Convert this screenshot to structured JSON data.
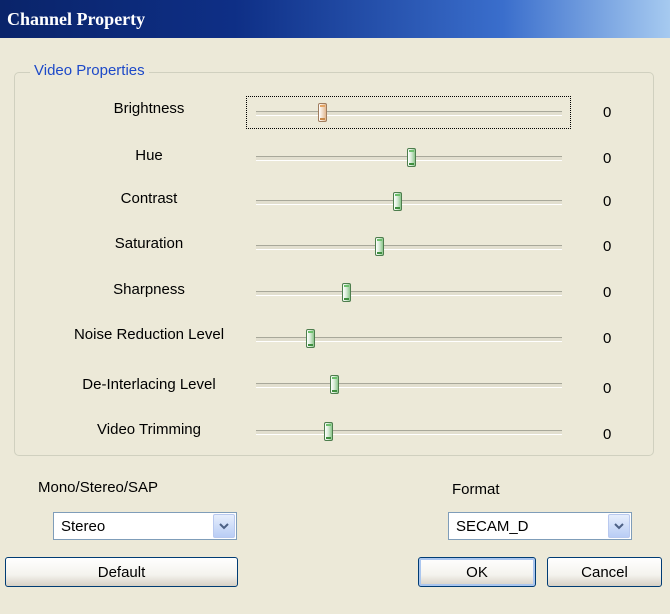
{
  "window": {
    "title": "Channel Property"
  },
  "video_properties": {
    "group_label": "Video Properties",
    "sliders": [
      {
        "label": "Brightness",
        "value": "0",
        "position": 0.21
      },
      {
        "label": "Hue",
        "value": "0",
        "position": 0.51
      },
      {
        "label": "Contrast",
        "value": "0",
        "position": 0.46
      },
      {
        "label": "Saturation",
        "value": "0",
        "position": 0.4
      },
      {
        "label": "Sharpness",
        "value": "0",
        "position": 0.29
      },
      {
        "label": "Noise Reduction Level",
        "value": "0",
        "position": 0.17
      },
      {
        "label": "De-Interlacing Level",
        "value": "0",
        "position": 0.25
      },
      {
        "label": "Video Trimming",
        "value": "0",
        "position": 0.23
      }
    ]
  },
  "audio": {
    "label": "Mono/Stereo/SAP",
    "selected": "Stereo"
  },
  "format": {
    "label": "Format",
    "selected": "SECAM_D"
  },
  "buttons": {
    "default": "Default",
    "ok": "OK",
    "cancel": "Cancel"
  },
  "colors": {
    "title_start": "#0a246a",
    "title_end": "#a6caf0",
    "dialog_bg": "#ece9d8",
    "group_label": "#1d49c8"
  }
}
